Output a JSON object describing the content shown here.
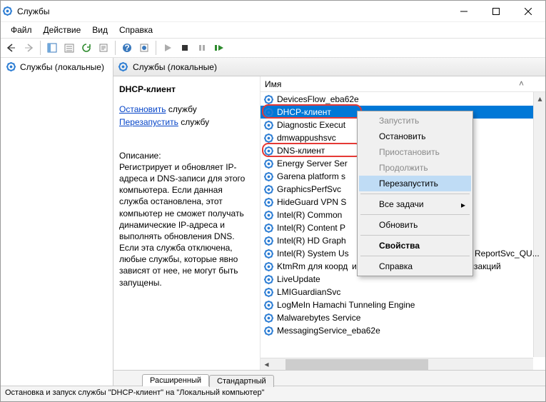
{
  "window": {
    "title": "Службы"
  },
  "menu": {
    "file": "Файл",
    "action": "Действие",
    "view": "Вид",
    "help": "Справка"
  },
  "left": {
    "node": "Службы (локальные)"
  },
  "panel": {
    "header": "Службы (локальные)",
    "selected_name": "DHCP-клиент",
    "stop_label": "Остановить",
    "restart_label": "Перезапустить",
    "service_word": "службу",
    "desc_label": "Описание:",
    "description": "Регистрирует и обновляет IP-адреса и DNS-записи для этого компьютера. Если данная служба остановлена, этот компьютер не сможет получать динамические IP-адреса и выполнять обновления DNS. Если эта служба отключена, любые службы, которые явно зависят от нее, не могут быть запущены."
  },
  "columns": {
    "name": "Имя"
  },
  "services": [
    "DevicesFlow_eba62e",
    "DHCP-клиент",
    "Diagnostic Execut",
    "dmwappushsvc",
    "DNS-клиент",
    "Energy Server Ser",
    "Garena platform s",
    "GraphicsPerfSvc",
    "HideGuard VPN S",
    "Intel(R) Common",
    "Intel(R) Content P",
    "Intel(R) HD Graph",
    "Intel(R) System Us",
    "KtmRm для коорд",
    "LiveUpdate",
    "LMIGuardianSvc",
    "LogMeIn Hamachi Tunneling Engine",
    "Malwarebytes Service",
    "MessagingService_eba62e"
  ],
  "truncated_tail": "ReportSvc_QU...",
  "long_row": "инатора распределенных транзакций",
  "context_menu": {
    "start": "Запустить",
    "stop": "Остановить",
    "pause": "Приостановить",
    "resume": "Продолжить",
    "restart": "Перезапустить",
    "all_tasks": "Все задачи",
    "refresh": "Обновить",
    "properties": "Свойства",
    "help": "Справка"
  },
  "tabs": {
    "extended": "Расширенный",
    "standard": "Стандартный"
  },
  "statusbar": "Остановка и запуск службы \"DHCP-клиент\" на \"Локальный компьютер\""
}
